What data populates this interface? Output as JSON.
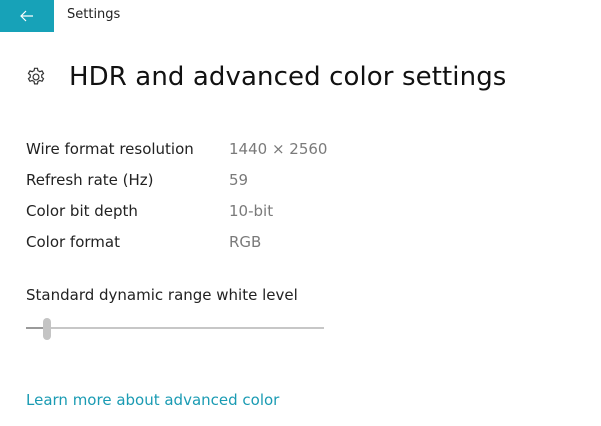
{
  "window": {
    "title": "Settings"
  },
  "header": {
    "icon": "gear-icon",
    "title": "HDR and advanced color settings"
  },
  "properties": [
    {
      "label": "Wire format resolution",
      "value": "1440 × 2560"
    },
    {
      "label": "Refresh rate (Hz)",
      "value": "59"
    },
    {
      "label": "Color bit depth",
      "value": "10-bit"
    },
    {
      "label": "Color format",
      "value": "RGB"
    }
  ],
  "sdr_white_level": {
    "label": "Standard dynamic range white level",
    "value_fraction": 0.07
  },
  "link": {
    "label": "Learn more about advanced color"
  },
  "colors": {
    "accent": "#17a2b8",
    "link": "#1a9bb3",
    "secondary_text": "#7a7a7a"
  }
}
